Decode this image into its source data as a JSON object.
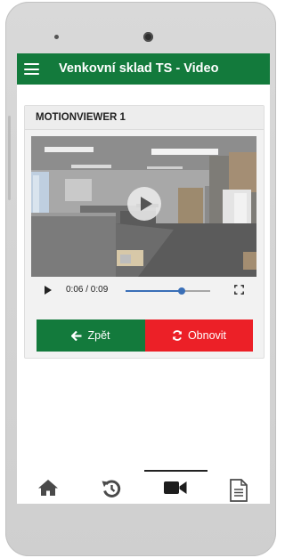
{
  "app": {
    "title": "Venkovní sklad TS - Video"
  },
  "card": {
    "title": "MOTIONVIEWER 1"
  },
  "player": {
    "time_display": "0:06 / 0:09",
    "progress": 0.667
  },
  "actions": {
    "back_label": "Zpět",
    "refresh_label": "Obnovit"
  },
  "bottom_nav": {
    "items": [
      {
        "name": "home",
        "icon": "home-icon",
        "active": false
      },
      {
        "name": "history",
        "icon": "history-icon",
        "active": false
      },
      {
        "name": "video",
        "icon": "video-camera-icon",
        "active": true
      },
      {
        "name": "document",
        "icon": "document-icon",
        "active": false
      }
    ]
  },
  "colors": {
    "primary": "#137a3c",
    "danger": "#ec2027",
    "accent": "#3a6fb7"
  }
}
